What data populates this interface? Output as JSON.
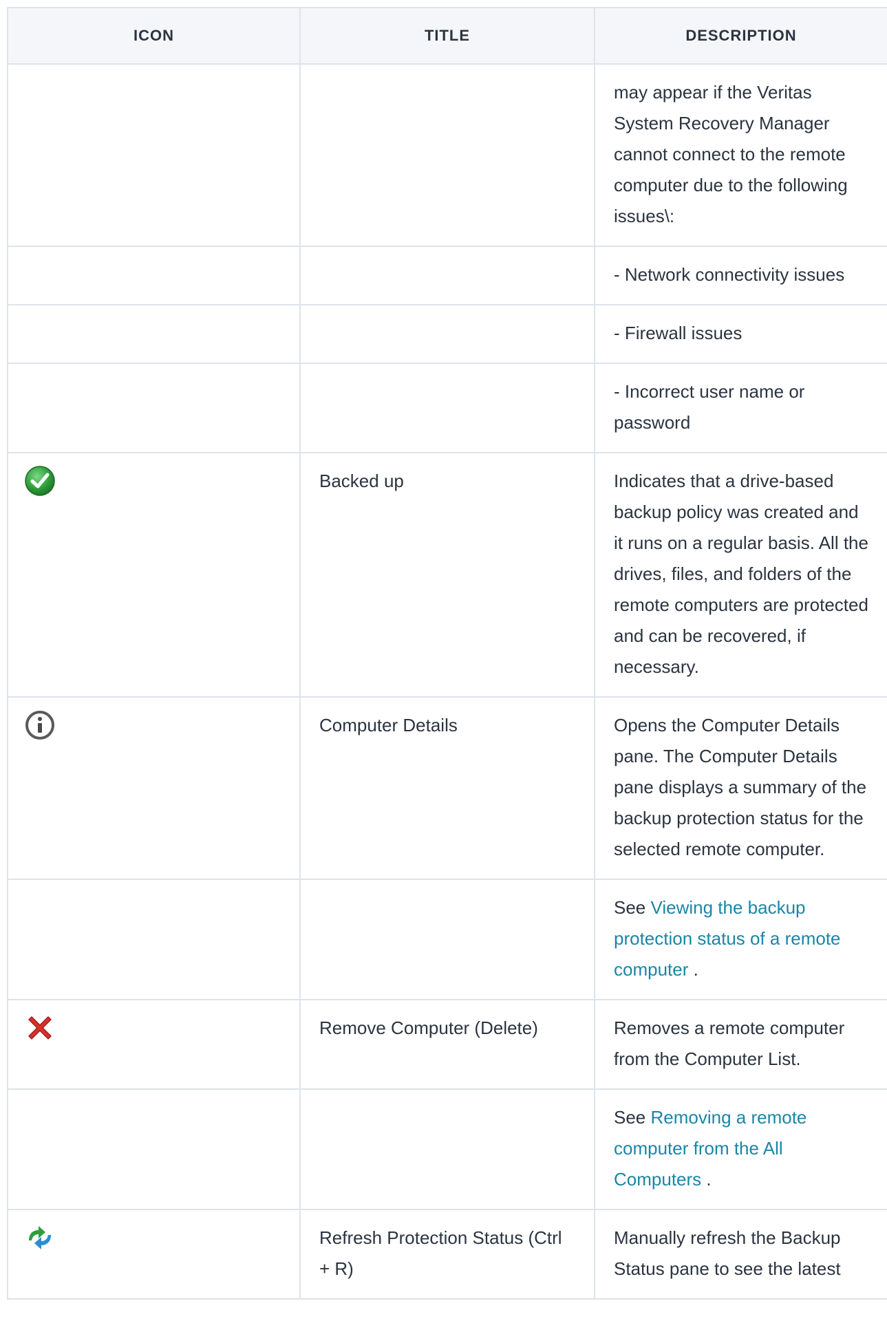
{
  "table": {
    "headers": {
      "icon": "ICON",
      "title": "TITLE",
      "description": "DESCRIPTION"
    },
    "rows": [
      {
        "icon": "",
        "title": "",
        "description": "may appear if the Veritas System Recovery Manager cannot connect to the remote computer due to the following issues\\:"
      },
      {
        "icon": "",
        "title": "",
        "description": "- Network connectivity issues"
      },
      {
        "icon": "",
        "title": "",
        "description": "- Firewall issues"
      },
      {
        "icon": "",
        "title": "",
        "description": "- Incorrect user name or password"
      },
      {
        "icon": "check-circle-icon",
        "title": "Backed up",
        "description": "Indicates that a drive-based backup policy was created and it runs on a regular basis. All the drives, files, and folders of the remote computers are protected and can be recovered, if necessary."
      },
      {
        "icon": "info-circle-icon",
        "title": "Computer Details",
        "description": "Opens the Computer Details pane. The Computer Details pane displays a summary of the backup protection status for the selected remote computer."
      },
      {
        "icon": "",
        "title": "",
        "description_prefix": "See ",
        "link_text": "Viewing the backup protection status of a remote computer",
        "description_suffix": " ."
      },
      {
        "icon": "red-x-icon",
        "title": "Remove Computer (Delete)",
        "description": "Removes a remote computer from the Computer List."
      },
      {
        "icon": "",
        "title": "",
        "description_prefix": "See ",
        "link_text": "Removing a remote computer from the All Computers",
        "description_suffix": " ."
      },
      {
        "icon": "refresh-arrows-icon",
        "title": "Refresh Protection Status (Ctrl + R)",
        "description": "Manually refresh the Backup Status pane to see the latest"
      }
    ]
  },
  "colors": {
    "border": "#dde3ec",
    "header_bg": "#f4f6f9",
    "text": "#2b3440",
    "link": "#1a86a6",
    "check_green": "#2e9e3a",
    "x_red": "#d8312b",
    "refresh_green": "#2f9e3e",
    "refresh_blue": "#2a8fd0"
  }
}
